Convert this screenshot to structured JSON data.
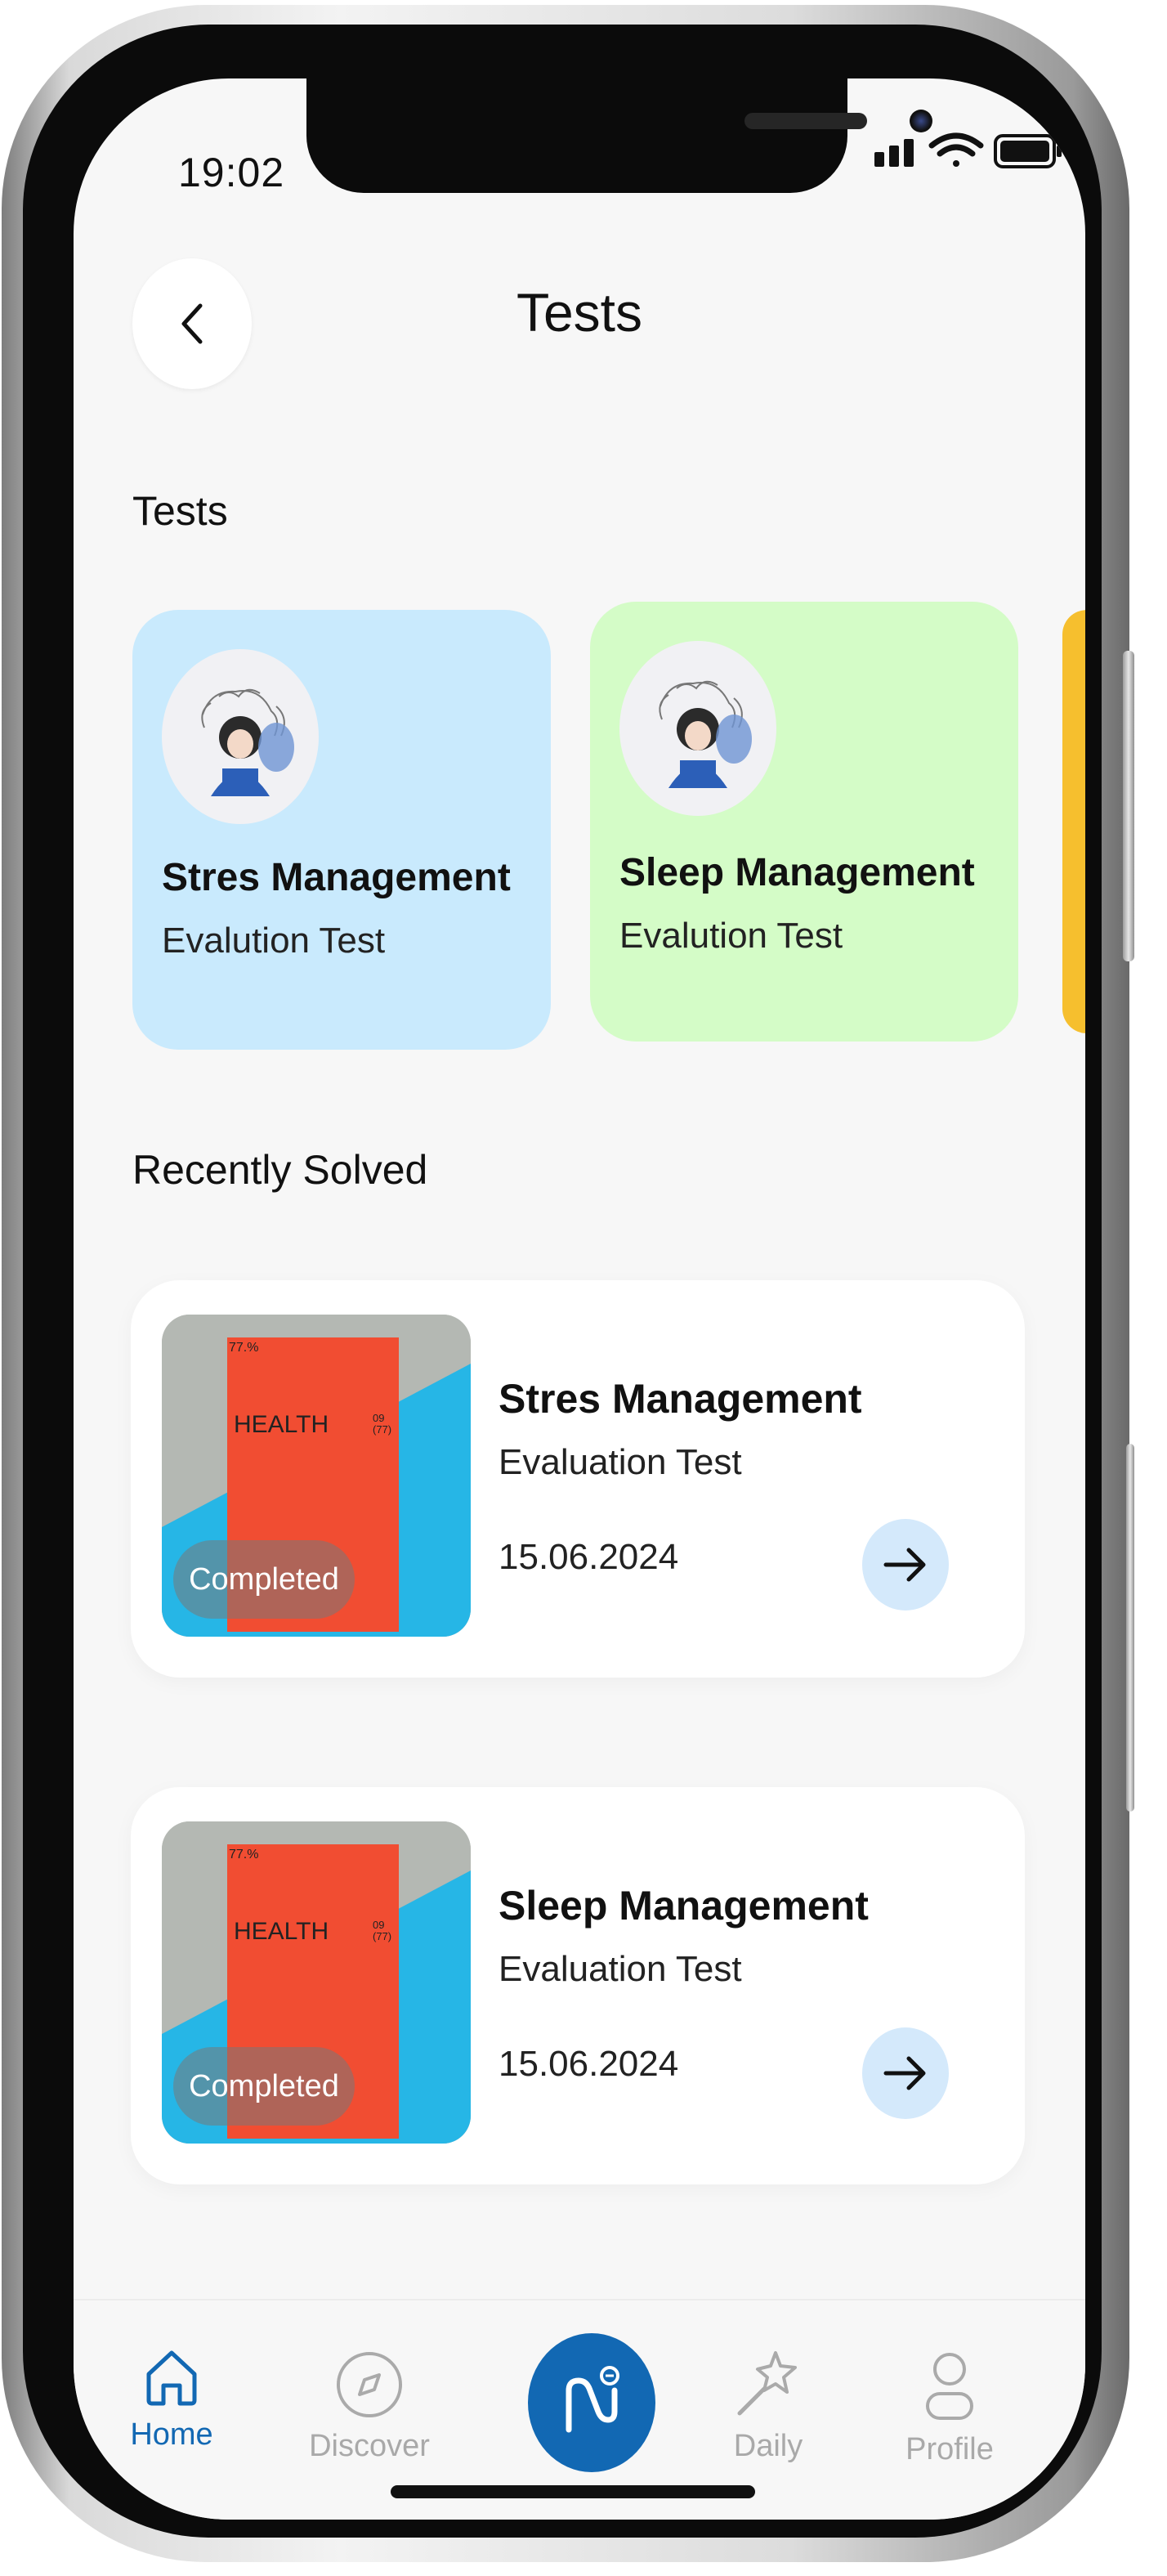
{
  "status_bar": {
    "time": "19:02"
  },
  "header": {
    "title": "Tests"
  },
  "sections": {
    "tests": "Tests",
    "recent": "Recently Solved"
  },
  "test_cards": [
    {
      "title": "Stres Management",
      "subtitle": "Evalution Test",
      "color": "#c9eafd"
    },
    {
      "title": "Sleep Management",
      "subtitle": "Evalution Test",
      "color": "#d4fcc7"
    }
  ],
  "peek_card_color": "#f6bf2e",
  "recent": [
    {
      "title": "Stres Management",
      "subtitle": "Evaluation Test",
      "date": "15.06.2024",
      "badge": "Completed",
      "thumb_text": "HEALTH",
      "thumb_small": "77.%",
      "thumb_num": "09\n(77)"
    },
    {
      "title": "Sleep Management",
      "subtitle": "Evaluation Test",
      "date": "15.06.2024",
      "badge": "Completed",
      "thumb_text": "HEALTH",
      "thumb_small": "77.%",
      "thumb_num": "09\n(77)"
    }
  ],
  "tabbar": {
    "items": [
      {
        "label": "Home",
        "icon": "home-icon",
        "active": true
      },
      {
        "label": "Discover",
        "icon": "compass-icon",
        "active": false
      },
      {
        "label": "",
        "icon": "brand-logo-icon",
        "active": false
      },
      {
        "label": "Daily",
        "icon": "magic-wand-icon",
        "active": false
      },
      {
        "label": "Profile",
        "icon": "user-icon",
        "active": false
      }
    ]
  },
  "colors": {
    "accent": "#1268b3",
    "arrow_bg": "#d4e9fb",
    "background": "#f7f7f7"
  }
}
